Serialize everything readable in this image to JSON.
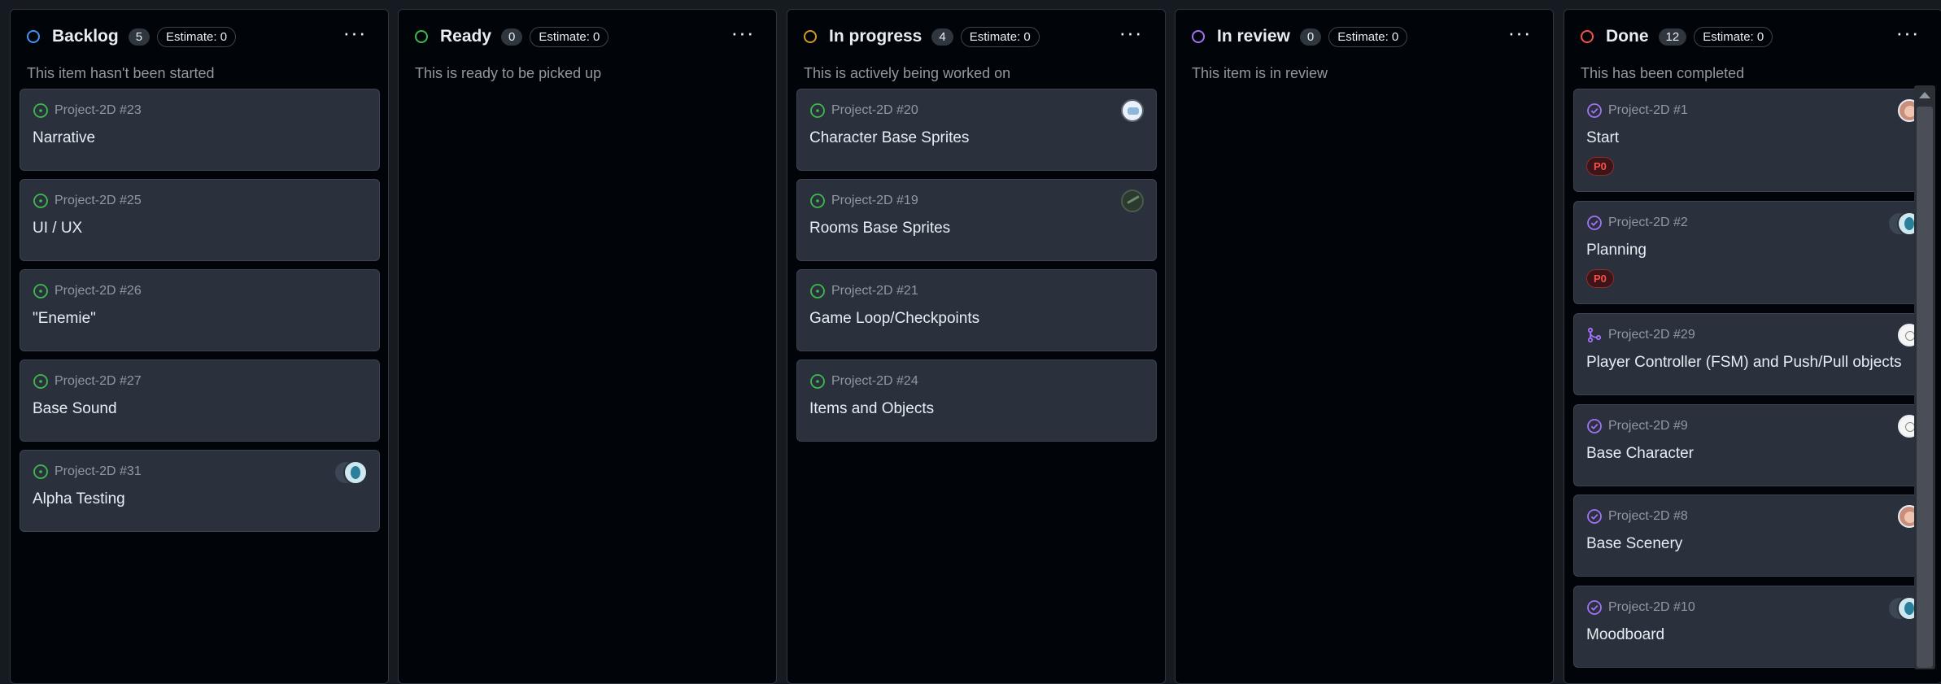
{
  "columns": [
    {
      "title": "Backlog",
      "count": "5",
      "estimate": "Estimate: 0",
      "menu": "···",
      "description": "This item hasn't been started",
      "color": "#4493f8",
      "cards": [
        {
          "ref": "Project-2D #23",
          "title": "Narrative",
          "state": "open"
        },
        {
          "ref": "Project-2D #25",
          "title": "UI / UX",
          "state": "open"
        },
        {
          "ref": "Project-2D #26",
          "title": "\"Enemie\"",
          "state": "open"
        },
        {
          "ref": "Project-2D #27",
          "title": "Base Sound",
          "state": "open"
        },
        {
          "ref": "Project-2D #31",
          "title": "Alpha Testing",
          "state": "open",
          "assignee": "pair"
        }
      ]
    },
    {
      "title": "Ready",
      "count": "0",
      "estimate": "Estimate: 0",
      "menu": "···",
      "description": "This is ready to be picked up",
      "color": "#3fb950",
      "cards": []
    },
    {
      "title": "In progress",
      "count": "4",
      "estimate": "Estimate: 0",
      "menu": "···",
      "description": "This is actively being worked on",
      "color": "#d29922",
      "cards": [
        {
          "ref": "Project-2D #20",
          "title": "Character Base Sprites",
          "state": "open",
          "assignee": "robot"
        },
        {
          "ref": "Project-2D #19",
          "title": "Rooms Base Sprites",
          "state": "open",
          "assignee": "dark"
        },
        {
          "ref": "Project-2D #21",
          "title": "Game Loop/Checkpoints",
          "state": "open"
        },
        {
          "ref": "Project-2D #24",
          "title": "Items and Objects",
          "state": "open"
        }
      ]
    },
    {
      "title": "In review",
      "count": "0",
      "estimate": "Estimate: 0",
      "menu": "···",
      "description": "This item is in review",
      "color": "#a371f7",
      "cards": []
    },
    {
      "title": "Done",
      "count": "12",
      "estimate": "Estimate: 0",
      "menu": "···",
      "description": "This has been completed",
      "color": "#f85149",
      "cards": [
        {
          "ref": "Project-2D #1",
          "title": "Start",
          "state": "closed",
          "assignee": "face",
          "label": "P0"
        },
        {
          "ref": "Project-2D #2",
          "title": "Planning",
          "state": "closed",
          "assignee": "pair",
          "label": "P0"
        },
        {
          "ref": "Project-2D #29",
          "title": "Player Controller (FSM) and Push/Pull objects",
          "state": "merged",
          "assignee": "sketch"
        },
        {
          "ref": "Project-2D #9",
          "title": "Base Character",
          "state": "closed",
          "assignee": "sketch"
        },
        {
          "ref": "Project-2D #8",
          "title": "Base Scenery",
          "state": "closed",
          "assignee": "face"
        },
        {
          "ref": "Project-2D #10",
          "title": "Moodboard",
          "state": "closed",
          "assignee": "pair"
        }
      ]
    }
  ],
  "colors": {
    "open_issue": "#3fb950",
    "closed_issue": "#a371f7",
    "merged_pr": "#a371f7",
    "label_p0": "#f85149"
  }
}
